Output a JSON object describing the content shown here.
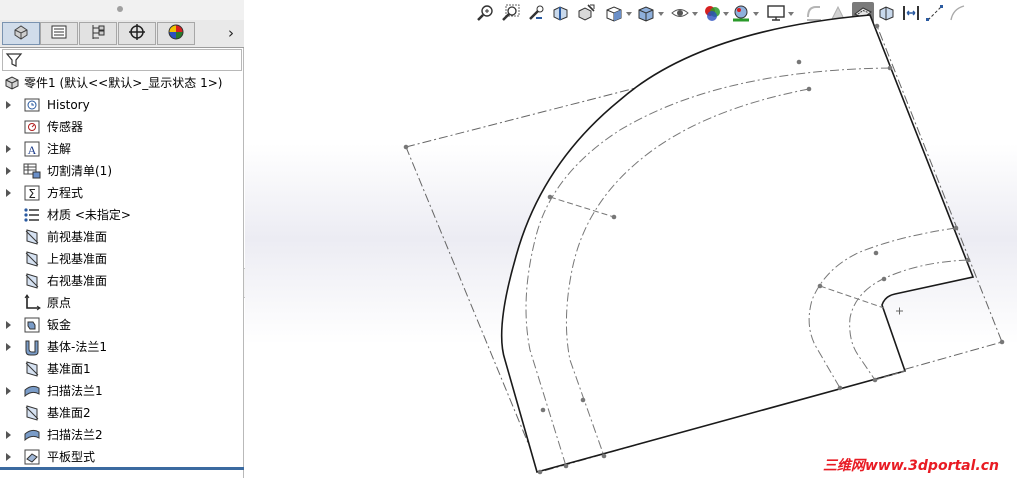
{
  "feature_manager": {
    "tabs": [
      {
        "icon": "feature-tree-icon",
        "active": true
      },
      {
        "icon": "property-manager-icon"
      },
      {
        "icon": "configuration-manager-icon"
      },
      {
        "icon": "dimxpert-icon"
      },
      {
        "icon": "display-manager-icon"
      }
    ],
    "filter_icon": "filter-icon",
    "part": {
      "label": "零件1  (默认<<默认>_显示状态 1>)",
      "icon": "part-icon"
    },
    "items": [
      {
        "label": "History",
        "icon": "history-icon",
        "expandable": true
      },
      {
        "label": "传感器",
        "icon": "sensors-icon",
        "expandable": false
      },
      {
        "label": "注解",
        "icon": "annotations-icon",
        "expandable": true
      },
      {
        "label": "切割清单(1)",
        "icon": "cut-list-icon",
        "expandable": true
      },
      {
        "label": "方程式",
        "icon": "equations-icon",
        "expandable": true
      },
      {
        "label": "材质 <未指定>",
        "icon": "material-icon",
        "expandable": false
      },
      {
        "label": "前视基准面",
        "icon": "plane-icon",
        "expandable": false
      },
      {
        "label": "上视基准面",
        "icon": "plane-icon",
        "expandable": false
      },
      {
        "label": "右视基准面",
        "icon": "plane-icon",
        "expandable": false
      },
      {
        "label": "原点",
        "icon": "origin-icon",
        "expandable": false
      },
      {
        "label": "钣金",
        "icon": "sheet-metal-icon",
        "expandable": true
      },
      {
        "label": "基体-法兰1",
        "icon": "base-flange-icon",
        "expandable": true
      },
      {
        "label": "基准面1",
        "icon": "plane-icon",
        "expandable": false
      },
      {
        "label": "扫描法兰1",
        "icon": "swept-flange-icon",
        "expandable": true
      },
      {
        "label": "基准面2",
        "icon": "plane-icon",
        "expandable": false
      },
      {
        "label": "扫描法兰2",
        "icon": "swept-flange-icon",
        "expandable": true
      },
      {
        "label": "平板型式",
        "icon": "flat-pattern-icon",
        "expandable": true
      }
    ]
  },
  "heads_up_toolbar": [
    "zoom-to-fit-icon",
    "zoom-to-area-icon",
    "previous-view-icon",
    "section-view-icon",
    "dynamic-annotation-icon",
    "view-orientation-icon",
    "display-style-icon",
    "hide-show-items-icon",
    "edit-appearance-icon",
    "apply-scene-icon",
    "view-settings-icon",
    "flatten-icon",
    "unflatten-icon",
    "flattened-icon",
    "no-bends-icon",
    "insert-bends-icon",
    "rip-icon",
    "sketch-icon"
  ],
  "watermark": {
    "cn": "三维网",
    "en": "www.3dportal.cn"
  },
  "colors": {
    "accent": "#3b6aa0",
    "watermark": "#e81b23"
  }
}
